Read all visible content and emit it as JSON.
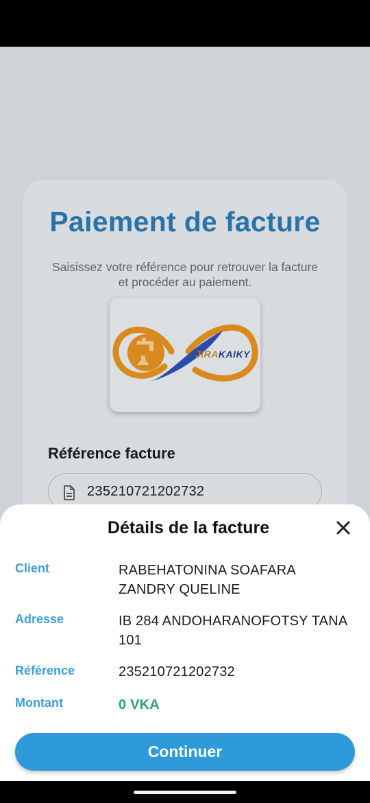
{
  "page": {
    "title": "Paiement de facture",
    "subtitle": "Saisissez votre référence pour retrouver la facture et procéder au paiement.",
    "logo": {
      "text_part1": "JIRA",
      "text_part2": "KAIKY"
    },
    "reference_label": "Référence facture",
    "reference_value": "235210721202732"
  },
  "sheet": {
    "title": "Détails de la facture",
    "rows": [
      {
        "label": "Client",
        "value": "RABEHATONINA SOAFARA ZANDRY QUELINE"
      },
      {
        "label": "Adresse",
        "value": "IB 284 ANDOHARANOFOTSY TANA 101"
      },
      {
        "label": "Référence",
        "value": "235210721202732"
      },
      {
        "label": "Montant",
        "value": "0 VKA"
      }
    ],
    "continue_label": "Continuer"
  },
  "icons": {
    "close": "close-icon",
    "document": "document-icon",
    "logo": "jirakaiky-logo"
  },
  "colors": {
    "title": "#2a73a8",
    "label": "#3a9fd6",
    "amount": "#2ba36a",
    "button": "#2e9ad9",
    "logo_orange": "#d98a1e",
    "logo_blue": "#2b4ba8"
  }
}
